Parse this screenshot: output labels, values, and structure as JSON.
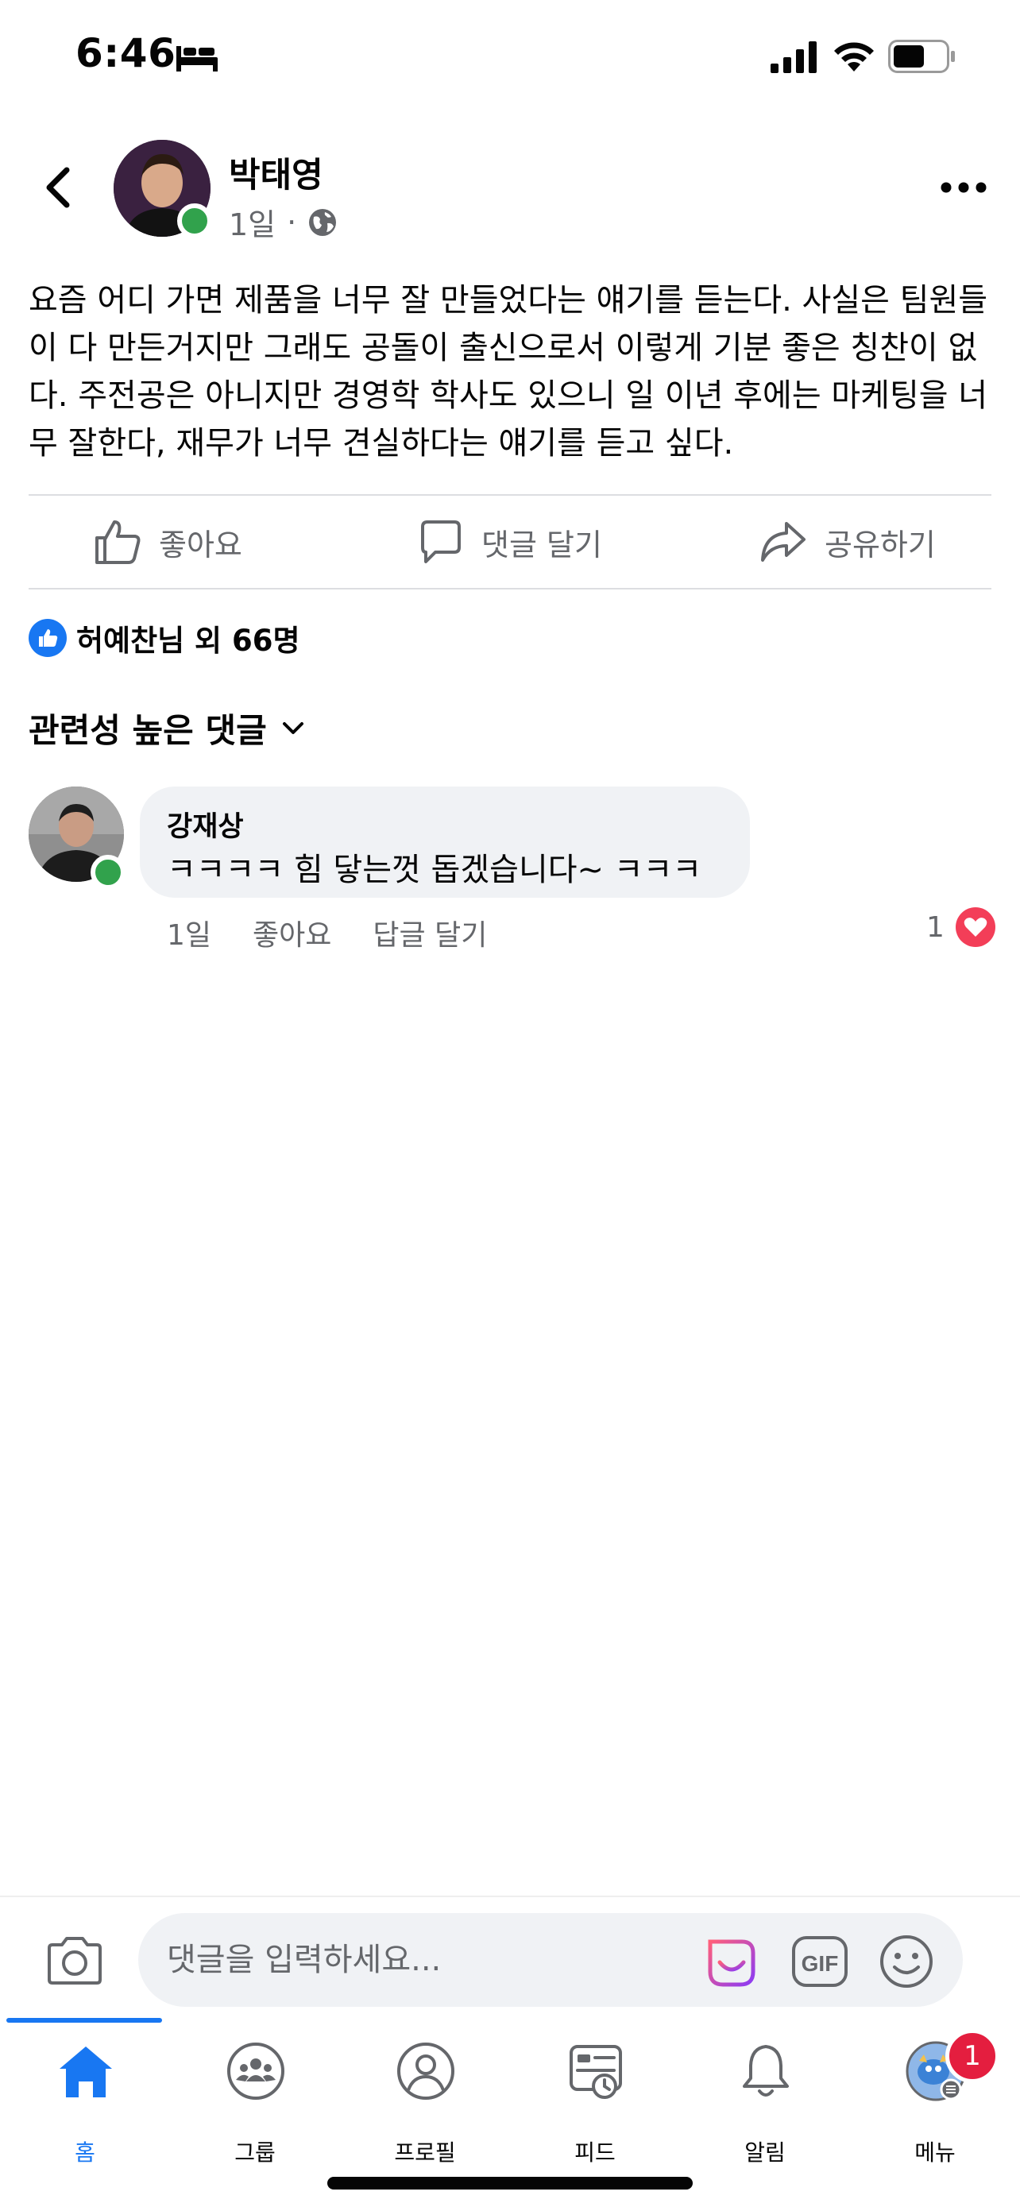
{
  "status_bar": {
    "time": "6:46",
    "focus_icon": "bed-icon",
    "battery_level": 0.55
  },
  "post": {
    "author_name": "박태영",
    "time_ago": "1일",
    "separator": "·",
    "audience_icon": "globe-icon",
    "body": "요즘 어디 가면 제품을 너무 잘 만들었다는 얘기를 듣는다. 사실은 팀원들이 다 만든거지만 그래도 공돌이 출신으로서 이렇게 기분 좋은 칭찬이 없다. 주전공은 아니지만 경영학 학사도 있으니 일 이년 후에는 마케팅을 너무 잘한다, 재무가 너무 견실하다는 얘기를 듣고 싶다."
  },
  "actions": {
    "like": "좋아요",
    "comment": "댓글 달기",
    "share": "공유하기"
  },
  "reactions": {
    "summary": "허예찬님 외 66명"
  },
  "comments_section": {
    "sort_label": "관련성 높은 댓글",
    "comments": [
      {
        "author": "강재상",
        "text": "ㅋㅋㅋㅋ 힘 닿는껏 돕겠습니다~ ㅋㅋㅋ",
        "time_ago": "1일",
        "like_label": "좋아요",
        "reply_label": "답글 달기",
        "reaction_count": "1"
      }
    ]
  },
  "composer": {
    "placeholder": "댓글을 입력하세요..."
  },
  "tab_bar": {
    "tabs": [
      {
        "label": "홈",
        "icon": "home-icon",
        "active": true
      },
      {
        "label": "그룹",
        "icon": "groups-icon",
        "active": false
      },
      {
        "label": "프로필",
        "icon": "profile-icon",
        "active": false
      },
      {
        "label": "피드",
        "icon": "feeds-icon",
        "active": false
      },
      {
        "label": "알림",
        "icon": "bell-icon",
        "active": false
      },
      {
        "label": "메뉴",
        "icon": "menu-avatar-icon",
        "active": false
      }
    ],
    "menu_badge": "1"
  },
  "colors": {
    "brand_blue": "#1877f2",
    "online_green": "#31a24c",
    "heart_red": "#f33e58",
    "badge_red": "#e41e3f",
    "secondary_text": "#65676b"
  }
}
